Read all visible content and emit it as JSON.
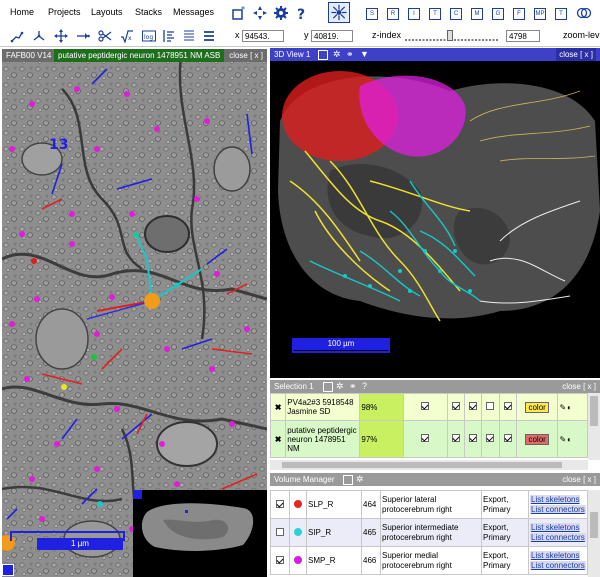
{
  "menubar": {
    "items": [
      "Home",
      "Projects",
      "Layouts",
      "Stacks",
      "Messages"
    ],
    "view_buttons": [
      "S",
      "R",
      "I",
      "T",
      "C",
      "M",
      "G",
      "F",
      "MP",
      "T"
    ]
  },
  "toolbar": {
    "x_label": "x",
    "x_value": "94543.",
    "y_label": "y",
    "y_value": "40819.",
    "z_index_label": "z-index",
    "z_index_value": "4798",
    "z_slider_level": 0.48,
    "zoom_label": "zoom-level"
  },
  "stack_view": {
    "title": "FAFB00 V14",
    "neuron_label": "putative peptidergic neuron 1478951 NM ASB",
    "close_label": "close [ x ]",
    "scale_label": "1 µm",
    "annotation": "13"
  },
  "view3d": {
    "title": "3D View 1",
    "close_label": "close [ x ]",
    "scale_label": "100 µm"
  },
  "selection": {
    "title": "Selection 1",
    "close_label": "close [ x ]",
    "rows": [
      {
        "name": "PV4a2#3 5918548 Jasmine SD",
        "percent": "98%",
        "color_label": "color",
        "color_bg": "#ffe94d"
      },
      {
        "name": "putative peptidergic neuron 1478951 NM",
        "percent": "97%",
        "color_label": "color",
        "color_bg": "#e06a6a"
      }
    ]
  },
  "volume_manager": {
    "title": "Volume Manager",
    "close_label": "close [ x ]",
    "rows": [
      {
        "checked": true,
        "color": "#e8251f",
        "name": "SLP_R",
        "id": "464",
        "desc": "Superior lateral protocerebrum right",
        "action": "Export, Primary",
        "skeletons": "List skeletons",
        "connectors": "List connectors"
      },
      {
        "checked": false,
        "color": "#2ad4d4",
        "name": "SIP_R",
        "id": "465",
        "desc": "Superior intermediate protocerebrum right",
        "action": "Export, Primary",
        "skeletons": "List skeletons",
        "connectors": "List connectors"
      },
      {
        "checked": true,
        "color": "#d81ed8",
        "name": "SMP_R",
        "id": "466",
        "desc": "Superior medial protocerebrum right",
        "action": "Export, Primary",
        "skeletons": "List skeletons",
        "connectors": "List connectors"
      }
    ]
  }
}
